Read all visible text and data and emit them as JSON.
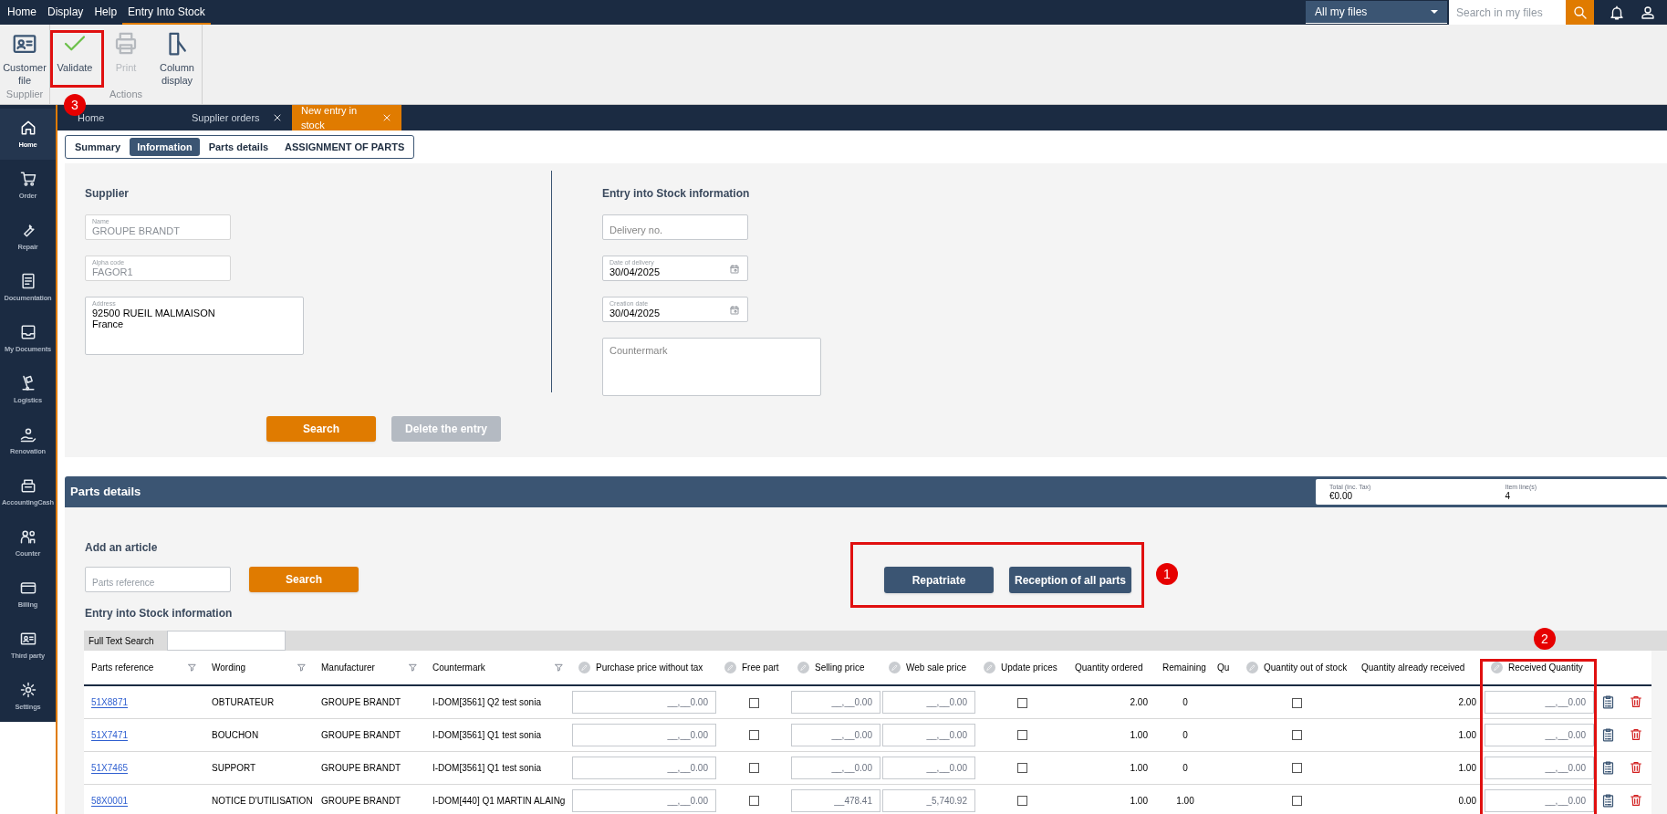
{
  "menu_bar": {
    "items": [
      {
        "label": "Home",
        "selected": false
      },
      {
        "label": "Display",
        "selected": false
      },
      {
        "label": "Help",
        "selected": false
      },
      {
        "label": "Entry Into Stock",
        "selected": true
      }
    ],
    "scope_select": {
      "value": "All my files"
    },
    "search": {
      "placeholder": "Search in my files"
    }
  },
  "ribbon": {
    "groups": [
      {
        "label": "Supplier",
        "buttons": [
          {
            "label": "Customer file",
            "disabled": false
          }
        ]
      },
      {
        "label": "Actions",
        "buttons": [
          {
            "label": "Validate",
            "disabled": false
          },
          {
            "label": "Print",
            "disabled": true
          },
          {
            "label": "Column display",
            "disabled": false
          }
        ]
      }
    ]
  },
  "sidebar": {
    "items": [
      {
        "label": "Home",
        "selected": true
      },
      {
        "label": "Order",
        "selected": false
      },
      {
        "label": "Repair",
        "selected": false
      },
      {
        "label": "Documentation",
        "selected": false
      },
      {
        "label": "My Documents",
        "selected": false
      },
      {
        "label": "Logistics",
        "selected": false
      },
      {
        "label": "Renovation",
        "selected": false
      },
      {
        "label": "AccountingCash",
        "selected": false
      },
      {
        "label": "Counter",
        "selected": false
      },
      {
        "label": "Billing",
        "selected": false
      },
      {
        "label": "Third party",
        "selected": false
      },
      {
        "label": "Settings",
        "selected": false
      }
    ]
  },
  "document_tabs": [
    {
      "label": "Home",
      "closable": false,
      "selected": false
    },
    {
      "label": "Supplier orders",
      "closable": true,
      "selected": false
    },
    {
      "label": "New entry in stock",
      "closable": true,
      "selected": true
    }
  ],
  "sub_tabs": [
    {
      "label": "Summary",
      "selected": false
    },
    {
      "label": "Information",
      "selected": true
    },
    {
      "label": "Parts details",
      "selected": false
    },
    {
      "label": "ASSIGNMENT OF PARTS",
      "selected": false
    }
  ],
  "supplier": {
    "title": "Supplier",
    "fields": [
      {
        "kind": "text",
        "label": "Name",
        "value": "GROUPE BRANDT",
        "disabled": true
      },
      {
        "kind": "text",
        "label": "Alpha code",
        "value": "FAGOR1",
        "disabled": true
      },
      {
        "kind": "textarea",
        "label": "Address",
        "value": "92500 RUEIL MALMAISON\nFrance",
        "disabled": false
      }
    ]
  },
  "entry_info": {
    "title": "Entry into Stock information",
    "fields": [
      {
        "kind": "text",
        "placeholder": "Delivery no.",
        "disabled": false
      },
      {
        "kind": "date",
        "label": "Date of delivery",
        "value": "30/04/2025",
        "disabled": false
      },
      {
        "kind": "date",
        "label": "Creation date",
        "value": "30/04/2025",
        "disabled": false
      },
      {
        "kind": "textarea",
        "placeholder": "Countermark",
        "disabled": false
      }
    ]
  },
  "form_buttons": [
    {
      "label": "Search",
      "disabled": false
    },
    {
      "label": "Delete the entry",
      "disabled": true
    }
  ],
  "parts_details": {
    "title": "Parts details",
    "totals": [
      {
        "label": "Total (Inc. Tax)",
        "value": "€0.00"
      },
      {
        "label": "Item line(s)",
        "value": "4"
      }
    ],
    "add_article": {
      "title": "Add an article",
      "placeholder": "Parts reference",
      "button": "Search"
    },
    "actions": [
      "Repatriate",
      "Reception of all parts"
    ],
    "table_title": "Entry into Stock information",
    "full_text_search": {
      "label": "Full Text Search"
    },
    "columns": [
      {
        "label": "Parts reference",
        "kind": "link",
        "filter": true,
        "editable": false
      },
      {
        "label": "Wording",
        "kind": "text",
        "filter": true,
        "editable": false
      },
      {
        "label": "Manufacturer",
        "kind": "text",
        "filter": true,
        "editable": false
      },
      {
        "label": "Countermark",
        "kind": "text",
        "filter": true,
        "editable": false
      },
      {
        "label": "Purchase price without tax",
        "kind": "input",
        "filter": false,
        "editable": true
      },
      {
        "label": "Free part",
        "kind": "checkbox",
        "filter": false,
        "editable": true
      },
      {
        "label": "Selling price",
        "kind": "input",
        "filter": false,
        "editable": true
      },
      {
        "label": "Web sale price",
        "kind": "input",
        "filter": false,
        "editable": true
      },
      {
        "label": "Update prices",
        "kind": "checkbox",
        "filter": false,
        "editable": true
      },
      {
        "label": "Quantity ordered",
        "kind": "number",
        "filter": false,
        "editable": false
      },
      {
        "label": "Remaining",
        "kind": "center",
        "filter": false,
        "editable": false
      },
      {
        "label": "Qu",
        "kind": "cut",
        "filter": false,
        "editable": false
      },
      {
        "label": "Quantity out of stock",
        "kind": "checkbox",
        "filter": false,
        "editable": true
      },
      {
        "label": "Quantity already received",
        "kind": "number",
        "filter": false,
        "editable": false
      },
      {
        "label": "Received Quantity",
        "kind": "input",
        "filter": false,
        "editable": true
      }
    ],
    "rows": [
      {
        "cells": [
          "51X8871",
          "OBTURATEUR",
          "GROUPE BRANDT",
          "I-DOM[3561] Q2 test  sonia",
          "__,__0.00",
          false,
          "__,__0.00",
          "__,__0.00",
          false,
          "2.00",
          "0",
          "",
          false,
          "2.00",
          "__,__0.00"
        ]
      },
      {
        "cells": [
          "51X7471",
          "BOUCHON",
          "GROUPE BRANDT",
          "I-DOM[3561] Q1 test  sonia",
          "__,__0.00",
          false,
          "__,__0.00",
          "__,__0.00",
          false,
          "1.00",
          "0",
          "",
          false,
          "1.00",
          "__,__0.00"
        ]
      },
      {
        "cells": [
          "51X7465",
          "SUPPORT",
          "GROUPE BRANDT",
          "I-DOM[3561] Q1 test  sonia",
          "__,__0.00",
          false,
          "__,__0.00",
          "__,__0.00",
          false,
          "1.00",
          "0",
          "",
          false,
          "1.00",
          "__,__0.00"
        ]
      },
      {
        "cells": [
          "58X0001",
          "NOTICE D'UTILISATION",
          "GROUPE BRANDT",
          "I-DOM[440] Q1 MARTIN ALAINg",
          "__,__0.00",
          false,
          "__478.41",
          "_5,740.92",
          false,
          "1.00",
          "1.00",
          "",
          false,
          "0.00",
          "__,__0.00"
        ]
      }
    ]
  },
  "annotations": [
    {
      "label": "3"
    },
    {
      "label": "1"
    },
    {
      "label": "2"
    }
  ]
}
